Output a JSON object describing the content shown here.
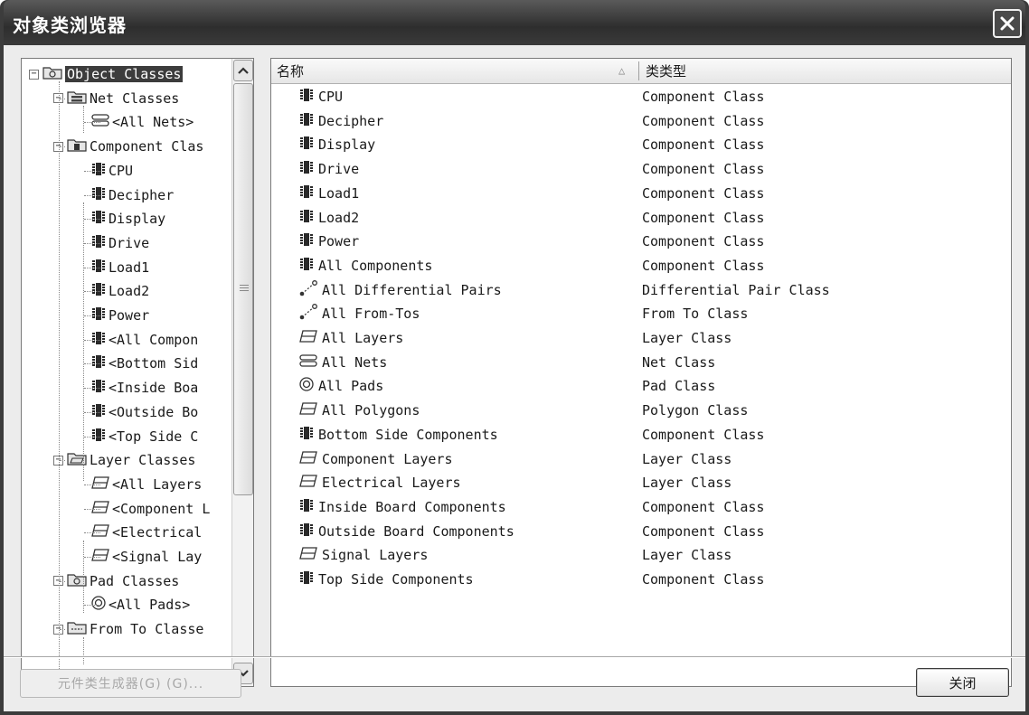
{
  "window": {
    "title": "对象类浏览器"
  },
  "tree": {
    "items": [
      {
        "label": "Object Classes",
        "level": 0,
        "icon": "object-classes-icon",
        "expander": "−",
        "selected": true
      },
      {
        "label": "Net Classes",
        "level": 1,
        "icon": "net-classes-icon",
        "expander": "−"
      },
      {
        "label": "<All Nets>",
        "level": 2,
        "icon": "net-icon"
      },
      {
        "label": "Component Clas",
        "level": 1,
        "icon": "component-classes-icon",
        "expander": "−"
      },
      {
        "label": "CPU",
        "level": 2,
        "icon": "component-icon"
      },
      {
        "label": "Decipher",
        "level": 2,
        "icon": "component-icon"
      },
      {
        "label": "Display",
        "level": 2,
        "icon": "component-icon"
      },
      {
        "label": "Drive",
        "level": 2,
        "icon": "component-icon"
      },
      {
        "label": "Load1",
        "level": 2,
        "icon": "component-icon"
      },
      {
        "label": "Load2",
        "level": 2,
        "icon": "component-icon"
      },
      {
        "label": "Power",
        "level": 2,
        "icon": "component-icon"
      },
      {
        "label": "<All Compon",
        "level": 2,
        "icon": "component-icon"
      },
      {
        "label": "<Bottom Sid",
        "level": 2,
        "icon": "component-icon"
      },
      {
        "label": "<Inside Boa",
        "level": 2,
        "icon": "component-icon"
      },
      {
        "label": "<Outside Bo",
        "level": 2,
        "icon": "component-icon"
      },
      {
        "label": "<Top Side C",
        "level": 2,
        "icon": "component-icon"
      },
      {
        "label": "Layer Classes",
        "level": 1,
        "icon": "layer-classes-icon",
        "expander": "−"
      },
      {
        "label": "<All Layers",
        "level": 2,
        "icon": "layer-icon"
      },
      {
        "label": "<Component L",
        "level": 2,
        "icon": "layer-icon"
      },
      {
        "label": "<Electrical",
        "level": 2,
        "icon": "layer-icon"
      },
      {
        "label": "<Signal Lay",
        "level": 2,
        "icon": "layer-icon"
      },
      {
        "label": "Pad Classes",
        "level": 1,
        "icon": "pad-classes-icon",
        "expander": "−"
      },
      {
        "label": "<All Pads>",
        "level": 2,
        "icon": "pad-icon"
      },
      {
        "label": "From To Classe",
        "level": 1,
        "icon": "from-to-classes-icon",
        "expander": "−"
      }
    ]
  },
  "list": {
    "columns": {
      "name": "名称",
      "type": "类类型",
      "sort_indicator": "△"
    },
    "rows": [
      {
        "name": "CPU",
        "type": "Component Class",
        "icon": "component-icon"
      },
      {
        "name": "Decipher",
        "type": "Component Class",
        "icon": "component-icon"
      },
      {
        "name": "Display",
        "type": "Component Class",
        "icon": "component-icon"
      },
      {
        "name": "Drive",
        "type": "Component Class",
        "icon": "component-icon"
      },
      {
        "name": "Load1",
        "type": "Component Class",
        "icon": "component-icon"
      },
      {
        "name": "Load2",
        "type": "Component Class",
        "icon": "component-icon"
      },
      {
        "name": "Power",
        "type": "Component Class",
        "icon": "component-icon"
      },
      {
        "name": "All Components",
        "type": "Component Class",
        "icon": "component-icon"
      },
      {
        "name": "All Differential Pairs",
        "type": "Differential Pair Class",
        "icon": "differential-pair-icon"
      },
      {
        "name": "All From-Tos",
        "type": "From To Class",
        "icon": "from-to-icon"
      },
      {
        "name": "All Layers",
        "type": "Layer Class",
        "icon": "layer-icon"
      },
      {
        "name": "All Nets",
        "type": "Net Class",
        "icon": "net-icon"
      },
      {
        "name": "All Pads",
        "type": "Pad Class",
        "icon": "pad-icon"
      },
      {
        "name": "All Polygons",
        "type": "Polygon Class",
        "icon": "layer-icon"
      },
      {
        "name": "Bottom Side Components",
        "type": "Component Class",
        "icon": "component-icon"
      },
      {
        "name": "Component Layers",
        "type": "Layer Class",
        "icon": "layer-icon"
      },
      {
        "name": "Electrical Layers",
        "type": "Layer Class",
        "icon": "layer-icon"
      },
      {
        "name": "Inside Board Components",
        "type": "Component Class",
        "icon": "component-icon"
      },
      {
        "name": "Outside Board Components",
        "type": "Component Class",
        "icon": "component-icon"
      },
      {
        "name": "Signal Layers",
        "type": "Layer Class",
        "icon": "layer-icon"
      },
      {
        "name": "Top Side Components",
        "type": "Component Class",
        "icon": "component-icon"
      }
    ]
  },
  "buttons": {
    "generator": "元件类生成器(G) (G)...",
    "close": "关闭"
  },
  "colors": {
    "titlebar": "#3c3c3c",
    "selection": "#3c3c3c",
    "panel_bg": "#ececec"
  }
}
